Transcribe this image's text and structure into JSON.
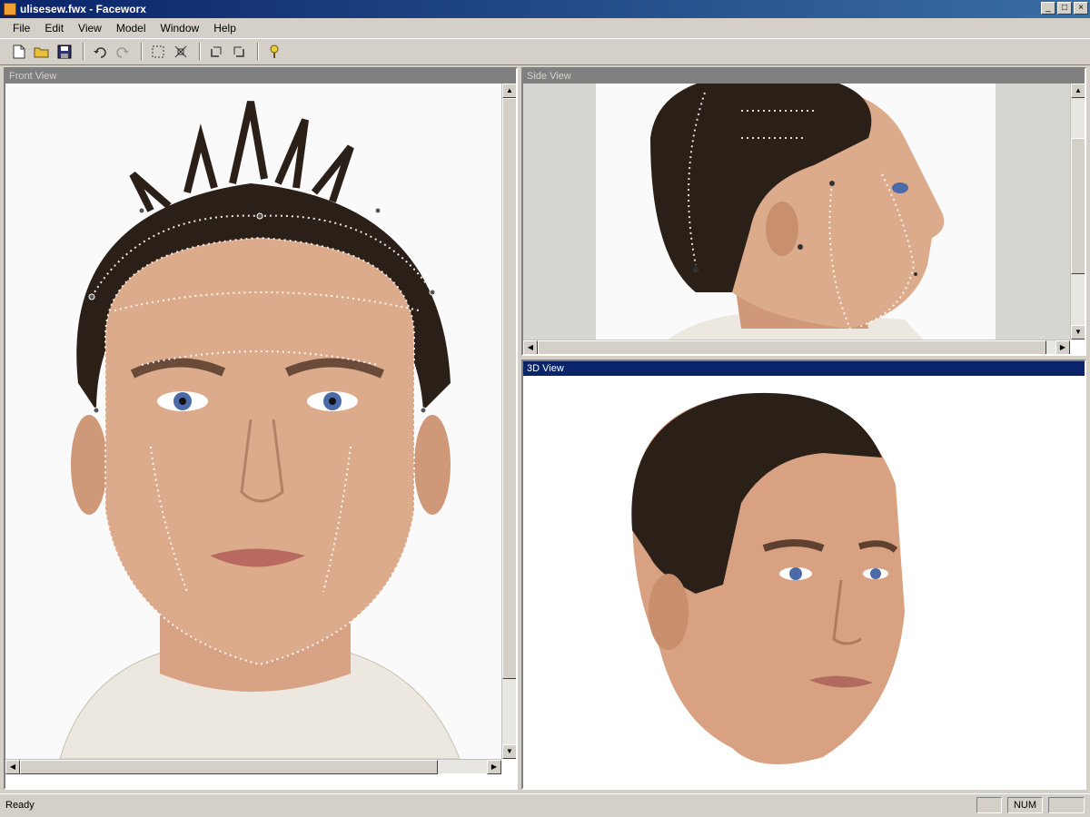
{
  "window": {
    "title": "ulisesew.fwx - Faceworx",
    "controls": [
      "_",
      "□",
      "×"
    ]
  },
  "menubar": [
    "File",
    "Edit",
    "View",
    "Model",
    "Window",
    "Help"
  ],
  "toolbar": {
    "icons": [
      "new-file-icon",
      "open-folder-icon",
      "save-icon",
      "undo-icon",
      "redo-icon",
      "select-icon",
      "fit-icon",
      "rotate-left-icon",
      "rotate-right-icon",
      "help-icon"
    ]
  },
  "panes": {
    "front": {
      "title": "Front View"
    },
    "side": {
      "title": "Side View"
    },
    "view3d": {
      "title": "3D View"
    }
  },
  "status": {
    "text": "Ready",
    "num": "NUM"
  },
  "colors": {
    "active_title": "#0a246a",
    "inactive_title": "#808080",
    "skin": "#d9a888",
    "hair": "#2a2018"
  }
}
